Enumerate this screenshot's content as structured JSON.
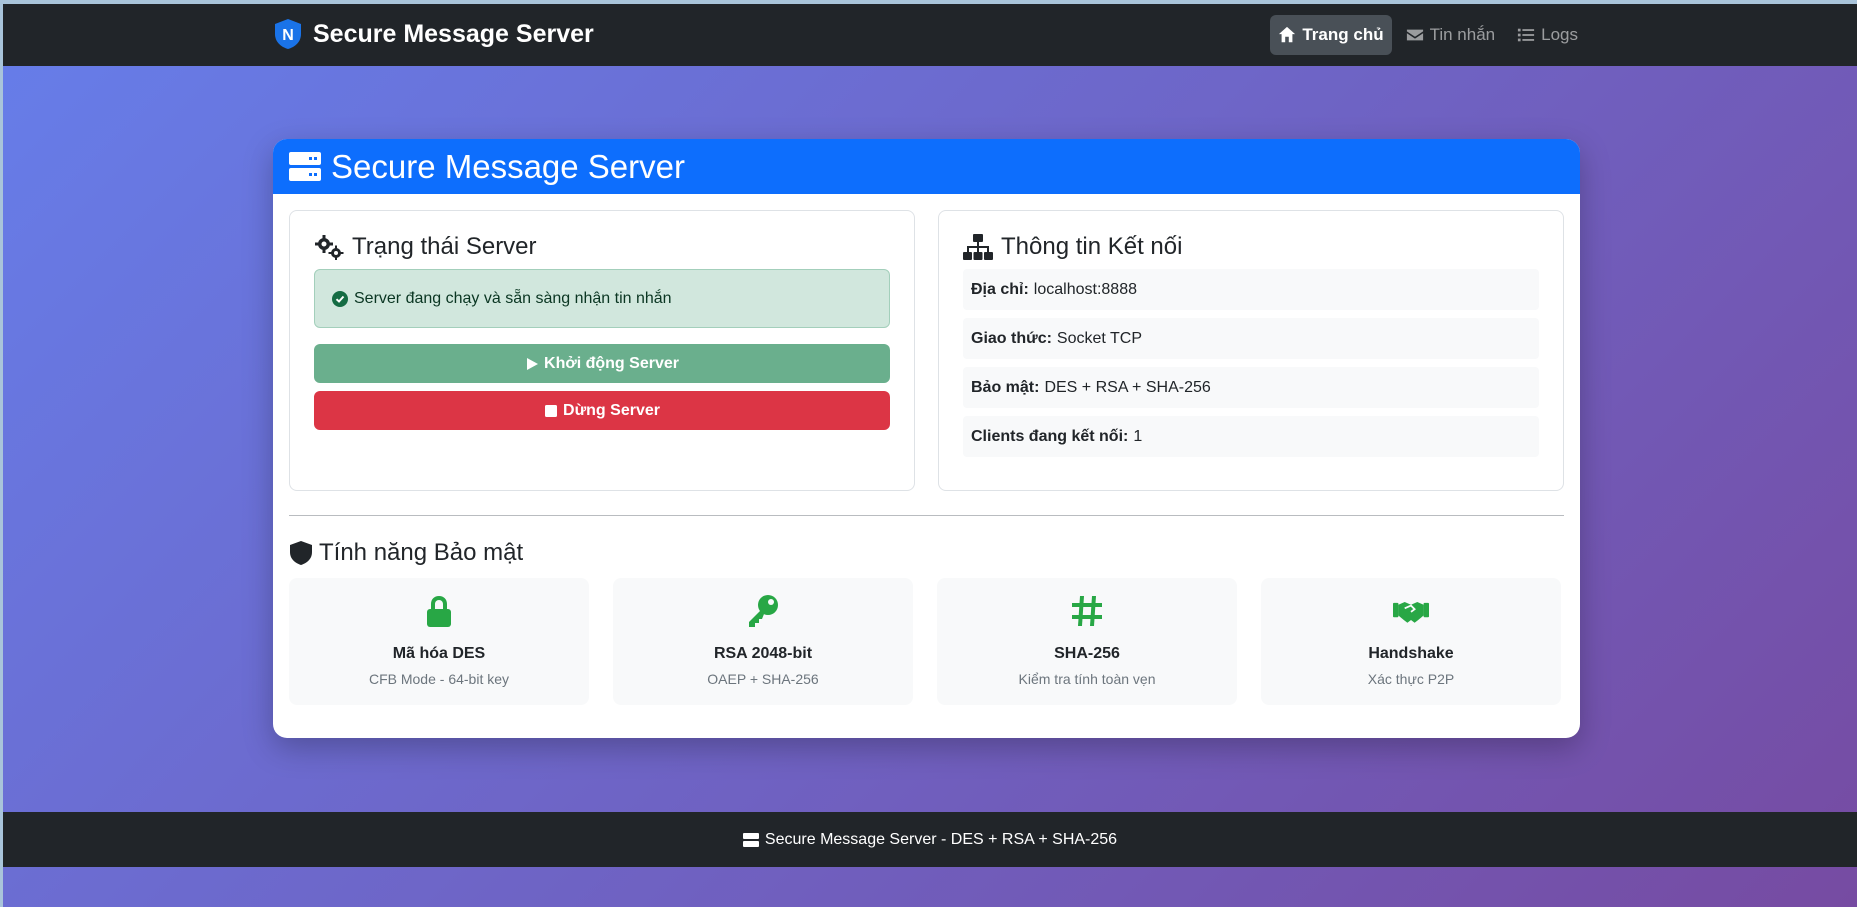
{
  "navbar": {
    "brand": "Secure Message Server",
    "brand_logo_letter": "N",
    "links": [
      {
        "label": "Trang chủ",
        "icon": "home-icon",
        "active": true
      },
      {
        "label": "Tin nhắn",
        "icon": "envelope-icon",
        "active": false
      },
      {
        "label": "Logs",
        "icon": "list-icon",
        "active": false
      }
    ]
  },
  "card": {
    "title": "Secure Message Server",
    "status_panel": {
      "title": "Trạng thái Server",
      "alert": "Server đang chạy và sẵn sàng nhận tin nhắn",
      "start_button": "Khởi động Server",
      "stop_button": "Dừng Server"
    },
    "connection_panel": {
      "title": "Thông tin Kết nối",
      "rows": [
        {
          "label": "Địa chỉ:",
          "value": "localhost:8888"
        },
        {
          "label": "Giao thức:",
          "value": "Socket TCP"
        },
        {
          "label": "Bảo mật:",
          "value": "DES + RSA + SHA-256"
        },
        {
          "label": "Clients đang kết nối:",
          "value": "1"
        }
      ]
    },
    "security_title": "Tính năng Bảo mật",
    "features": [
      {
        "title": "Mã hóa DES",
        "subtitle": "CFB Mode - 64-bit key",
        "icon": "lock-icon"
      },
      {
        "title": "RSA 2048-bit",
        "subtitle": "OAEP + SHA-256",
        "icon": "key-icon"
      },
      {
        "title": "SHA-256",
        "subtitle": "Kiểm tra tính toàn vẹn",
        "icon": "hash-icon"
      },
      {
        "title": "Handshake",
        "subtitle": "Xác thực P2P",
        "icon": "handshake-icon"
      }
    ]
  },
  "footer": {
    "text": "Secure Message Server - DES + RSA + SHA-256"
  },
  "colors": {
    "navbar_bg": "#212529",
    "header_blue": "#0d6efd",
    "success_green": "#28a745",
    "start_button": "#6aaf8d",
    "stop_button": "#dc3545",
    "gradient_start": "#667eea",
    "gradient_end": "#764ba2"
  }
}
